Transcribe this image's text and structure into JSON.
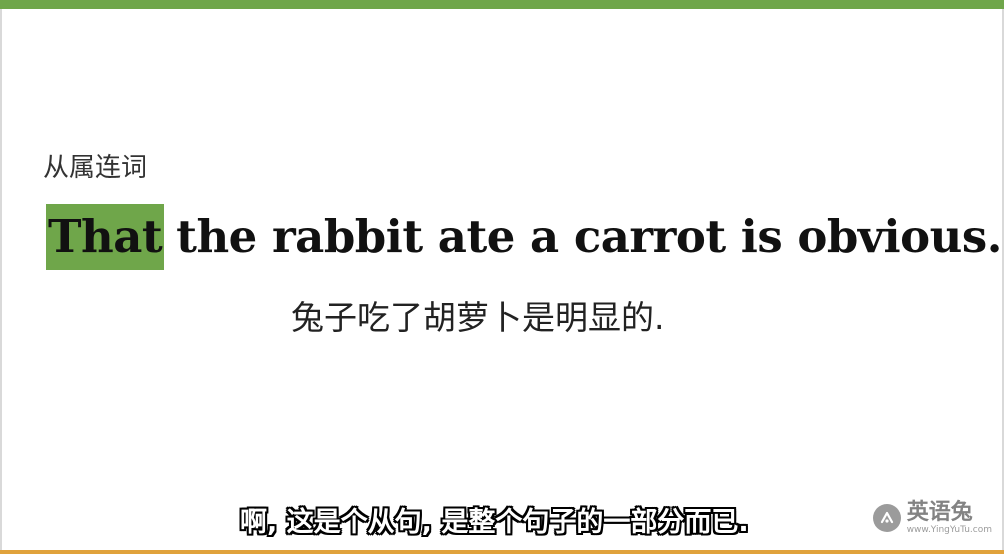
{
  "colors": {
    "top_bar": "#6fa64a",
    "highlight": "#6fa64a",
    "bottom_bar": "#e0a23c"
  },
  "slide": {
    "section_label": "从属连词",
    "sentence_highlight": "That",
    "sentence_rest": "the rabbit ate a carrot is obvious.",
    "translation": "兔子吃了胡萝卜是明显的."
  },
  "subtitle": {
    "text": "啊, 这是个从句, 是整个句子的一部分而已."
  },
  "watermark": {
    "icon": "rabbit-logo-icon",
    "name": "英语兔",
    "url": "www.YingYuTu.com"
  }
}
